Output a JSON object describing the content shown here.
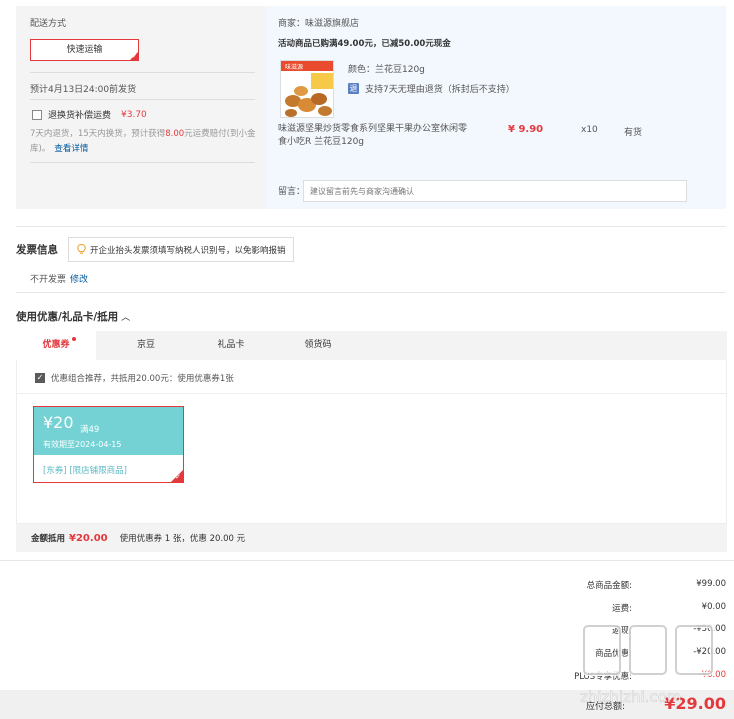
{
  "shipping": {
    "title": "配送方式",
    "method": "快速运输",
    "eta": "预计4月13日24:00前发货",
    "insurance_label": "退换货补偿运费",
    "insurance_price": "¥3.70",
    "note_pre": "7天内退货，15天内换货，预计获得",
    "note_amount": "8.00",
    "note_post": "元运费赔付(到小金库)。",
    "detail_link": "查看详情"
  },
  "order": {
    "shop": "商家：味滋源旗舰店",
    "promo": "活动商品已购满49.00元，已减50.00元现金",
    "color": "颜色：兰花豆120g",
    "return_icon": "退",
    "return_policy": "支持7天无理由退货（拆封后不支持）",
    "product_name": "味滋源坚果炒货零食系列坚果干果办公室休闲零食小吃R 兰花豆120g",
    "price": "¥ 9.90",
    "qty": "x10",
    "stock": "有货",
    "memo_label": "留言：",
    "memo_placeholder": "建议留言前先与商家沟通确认",
    "thumb_label": "味滋源"
  },
  "invoice": {
    "title": "发票信息",
    "tip": "开企业抬头发票须填写纳税人识别号，以免影响报销",
    "value": "不开发票",
    "edit": "修改"
  },
  "coupons": {
    "title": "使用优惠/礼品卡/抵用",
    "tabs": [
      "优惠券",
      "京豆",
      "礼品卡",
      "领货码"
    ],
    "combo_text": "优惠组合推荐，共抵用20.00元：使用优惠券1张",
    "card": {
      "amount": "¥20",
      "condition": "满49",
      "expiry": "有效期至2024-04-15",
      "scope": "[东券] [限店铺限商品]"
    },
    "summary_label": "金额抵用",
    "summary_amount": "¥20.00",
    "summary_detail": "使用优惠券 1 张，优惠 20.00 元"
  },
  "totals": [
    {
      "label": "总商品金额:",
      "value": "¥99.00"
    },
    {
      "label": "运费:",
      "value": "¥0.00"
    },
    {
      "label": "返现:",
      "value": "-¥50.00"
    },
    {
      "label": "商品优惠:",
      "value": "-¥20.00"
    },
    {
      "label": "PLUS专享优惠:",
      "value": "-¥0.00"
    }
  ],
  "footer": {
    "label": "应付总额:",
    "value": "¥29.00"
  },
  "watermark": "值 什么值得买 zhizhizhi.com",
  "colors": {
    "accent": "#e4393c",
    "link": "#005aa0",
    "coupon": "#74d2d4"
  }
}
